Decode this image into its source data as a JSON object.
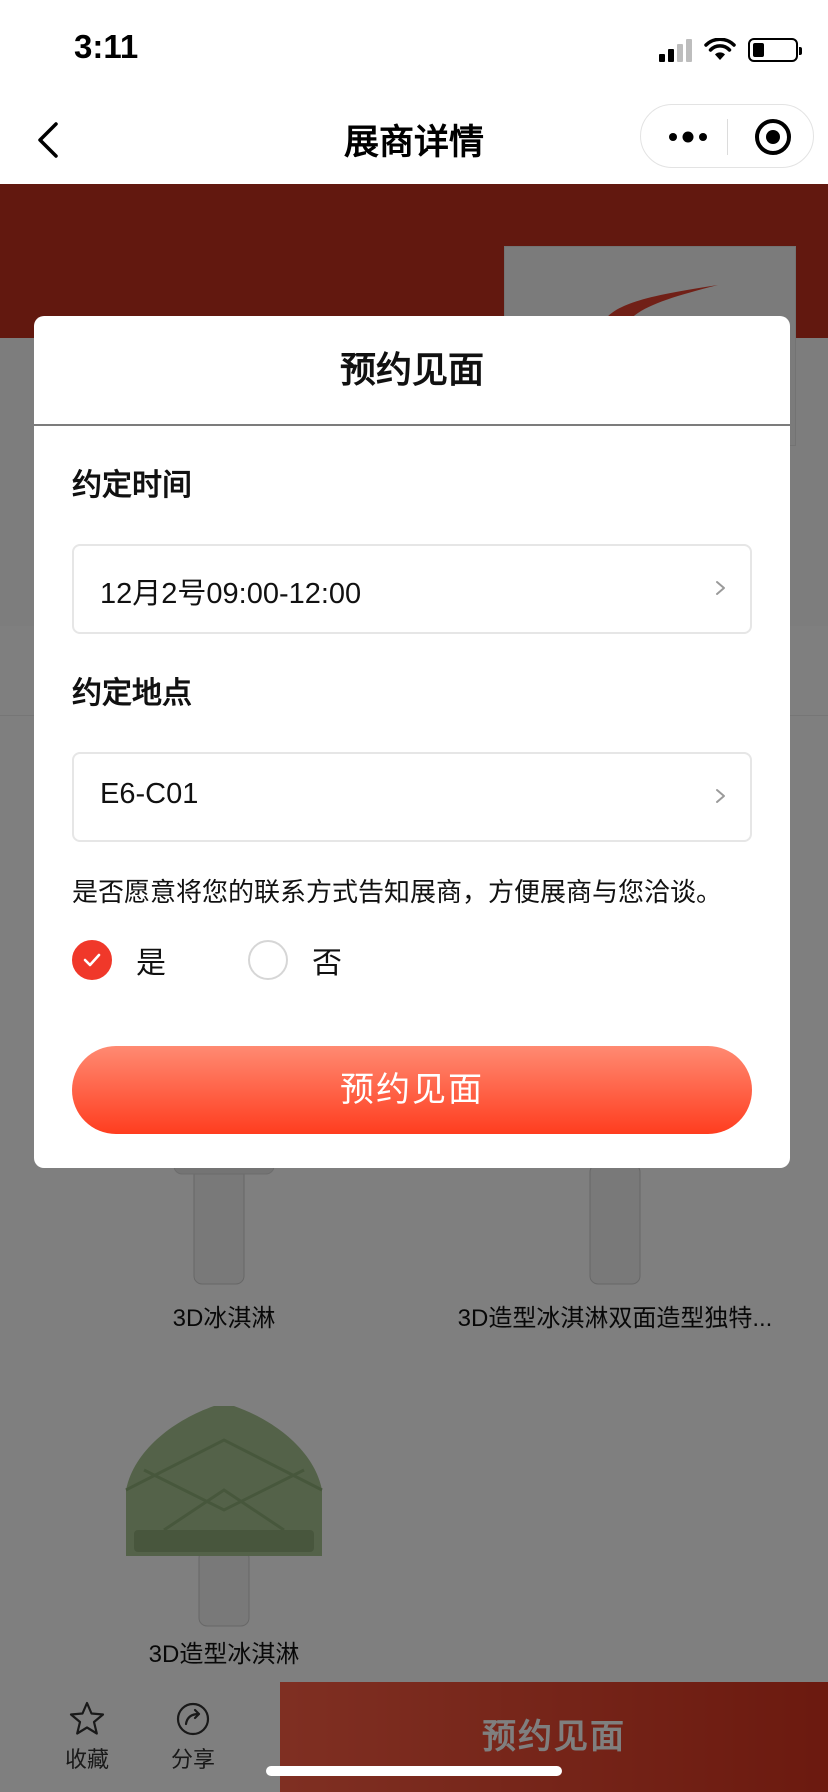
{
  "status_bar": {
    "time": "3:11"
  },
  "nav": {
    "title": "展商详情",
    "back_icon": "chevron-left-icon",
    "more_icon": "more-dots-icon",
    "close_icon": "target-circle-icon"
  },
  "background": {
    "products": [
      {
        "name": "3D冰淇淋",
        "color": "#e6e6e6"
      },
      {
        "name": "3D造型冰淇淋双面造型独特...",
        "color": "#3a2a22"
      },
      {
        "name": "3D造型冰淇淋",
        "color": "#a8c492"
      }
    ],
    "bottom_bar": {
      "favorite": {
        "label": "收藏",
        "icon": "star-icon"
      },
      "share": {
        "label": "分享",
        "icon": "share-icon"
      },
      "cta": "预约见面"
    },
    "brand_color": "#c4301f"
  },
  "modal": {
    "title": "预约见面",
    "time_label": "约定时间",
    "time_value": "12月2号09:00-12:00",
    "place_label": "约定地点",
    "place_value": "E6-C01",
    "consent_text": "是否愿意将您的联系方式告知展商，方便展商与您洽谈。",
    "options": [
      {
        "label": "是",
        "selected": true
      },
      {
        "label": "否",
        "selected": false
      }
    ],
    "submit_label": "预约见面",
    "accent_color": "#f0382a"
  }
}
